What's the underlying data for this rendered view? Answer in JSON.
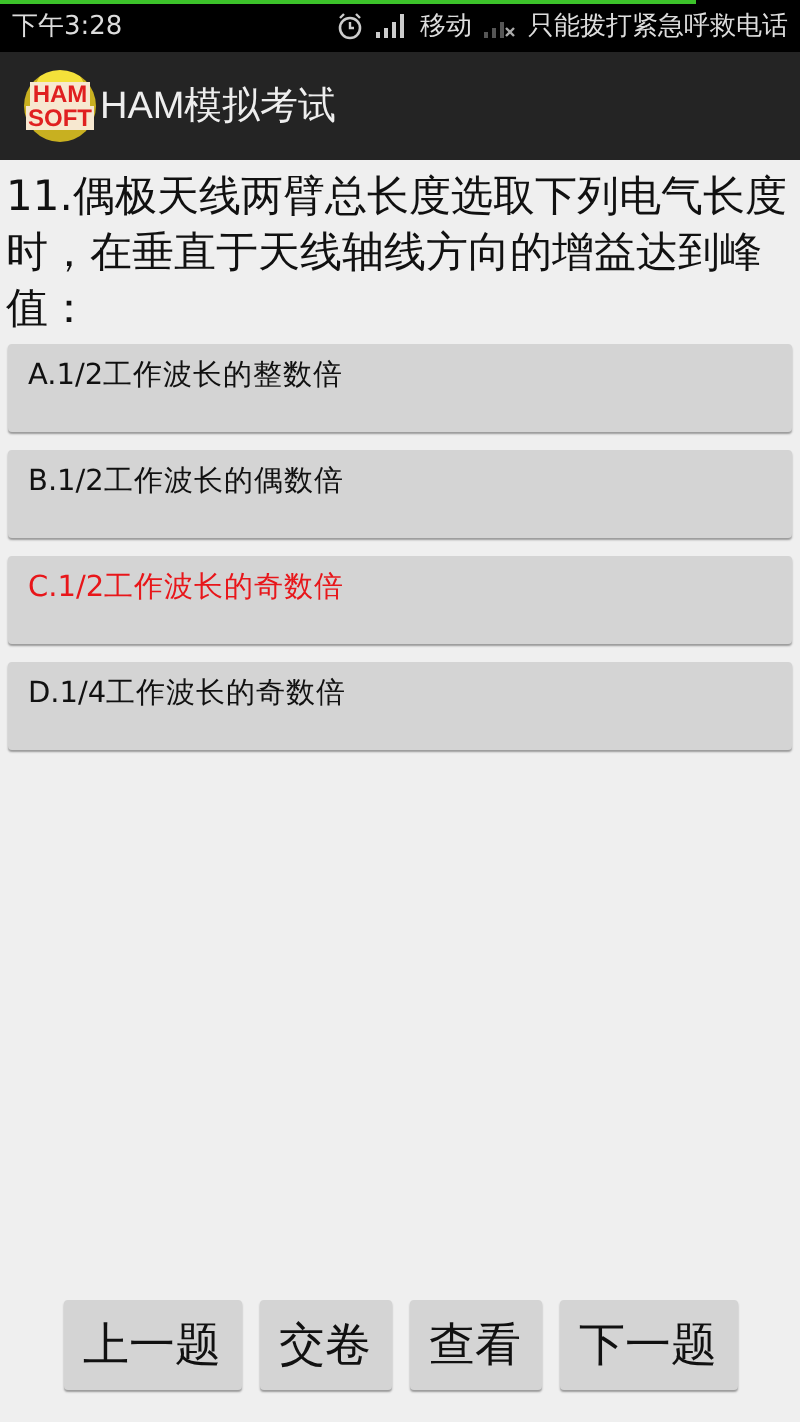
{
  "status_bar": {
    "time": "下午3:28",
    "carrier": "移动",
    "network_note": "只能拨打紧急呼救电话",
    "top_line": {
      "level": 0.87
    }
  },
  "app_bar": {
    "logo_lines": [
      "HAM",
      "SOFT"
    ],
    "title": "HAM模拟考试"
  },
  "question": "11.偶极天线两臂总长度选取下列电气长度时，在垂直于天线轴线方向的增益达到峰值：",
  "options": [
    {
      "label": "A.1/2工作波长的整数倍",
      "selected": false
    },
    {
      "label": "B.1/2工作波长的偶数倍",
      "selected": false
    },
    {
      "label": "C.1/2工作波长的奇数倍",
      "selected": true
    },
    {
      "label": "D.1/4工作波长的奇数倍",
      "selected": false
    }
  ],
  "buttons": [
    "上一题",
    "交卷",
    "查看",
    "下一题"
  ]
}
